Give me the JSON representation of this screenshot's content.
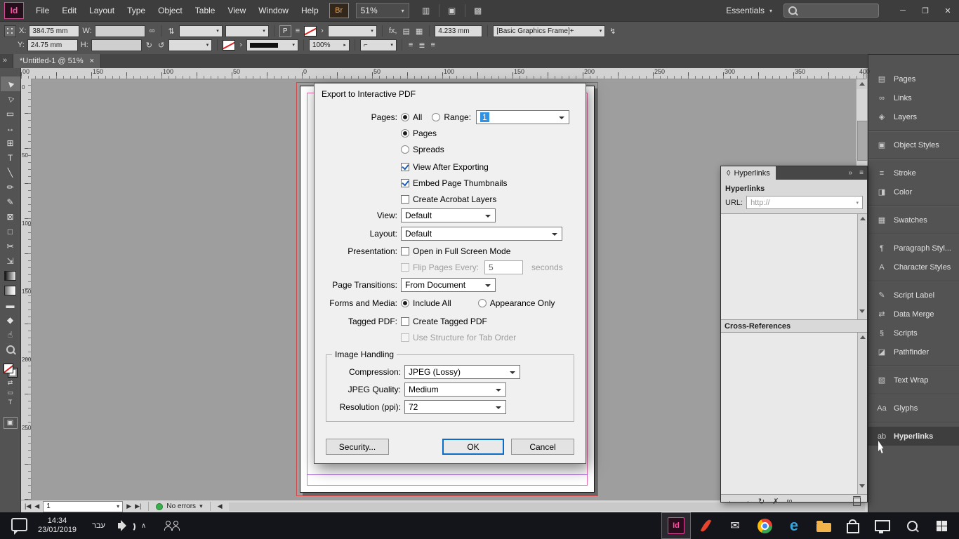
{
  "titlebar": {
    "logo": "Id",
    "menus": [
      "File",
      "Edit",
      "Layout",
      "Type",
      "Object",
      "Table",
      "View",
      "Window",
      "Help"
    ],
    "bridge": "Br",
    "zoom": "51%",
    "workspace": "Essentials",
    "minimize": "─",
    "restore": "❐",
    "close": "✕"
  },
  "control_panel": {
    "x_label": "X:",
    "x_value": "384.75 mm",
    "y_label": "Y:",
    "y_value": "24.75 mm",
    "w_label": "W:",
    "w_value": "",
    "h_label": "H:",
    "h_value": "",
    "scale_value": "100%",
    "gap_value": "4.233 mm",
    "style_value": "[Basic Graphics Frame]+",
    "p_badge": "P",
    "fx_label": "fx,"
  },
  "doc_tab": {
    "title": "*Untitled-1 @ 51%",
    "close": "×"
  },
  "rulers": {
    "h_labels": [
      "00",
      "150",
      "100",
      "50",
      "0",
      "50",
      "100",
      "150",
      "200",
      "250",
      "300",
      "350",
      "400"
    ],
    "v_labels": [
      "0",
      "50",
      "100",
      "150",
      "200",
      "250"
    ]
  },
  "tools": [
    "▶",
    "▷",
    "▭",
    "↔",
    "⊞",
    "T",
    "╲",
    "✏",
    "✎",
    "⊠",
    "□",
    "✂",
    "⇲",
    "",
    "",
    "▬",
    "◆",
    "☝",
    ""
  ],
  "glyphs": {
    "collapse_left": "»",
    "menu_icon_1": "▥",
    "menu_icon_2": "▣",
    "menu_icon_3": "▩",
    "workspace_caret": "▾",
    "flip_v": "⇅",
    "flip_h": "⇆",
    "rot_cw": "↻",
    "rot_ccw": "↺",
    "align_1": "≡",
    "align_2": "≣",
    "corner": "⌐",
    "scale_caret": "▸",
    "chain": "∞",
    "bolt": "↯",
    "text_icon": "▤",
    "grid_icon": "▦",
    "first_page": "|◀",
    "prev_page": "◀",
    "next_page": "▶",
    "last_page": "▶|",
    "errors_caret": "▾",
    "hscroll_left": "◀",
    "panel_diamond": "◊",
    "panel_collapse": "»",
    "panel_menu": "≡",
    "nav_prev": "←",
    "nav_next": "→",
    "refresh": "↻",
    "del": "✗",
    "link": "∞",
    "mini_1": "⇄",
    "mini_2": "▭",
    "mini_3": "T",
    "viewmode": "▣"
  },
  "dialog": {
    "title": "Export to Interactive PDF",
    "pages_label": "Pages:",
    "all_label": "All",
    "range_label": "Range:",
    "range_value": "1",
    "pages_option": "Pages",
    "spreads_option": "Spreads",
    "view_after_label": "View After Exporting",
    "embed_label": "Embed Page Thumbnails",
    "acrobat_label": "Create Acrobat Layers",
    "view_label": "View:",
    "view_value": "Default",
    "layout_label": "Layout:",
    "layout_value": "Default",
    "presentation_label": "Presentation:",
    "fullscreen_label": "Open in Full Screen Mode",
    "flip_label": "Flip Pages Every:",
    "flip_value": "5",
    "seconds_label": "seconds",
    "transitions_label": "Page Transitions:",
    "transitions_value": "From Document",
    "forms_label": "Forms and Media:",
    "include_all_label": "Include All",
    "appearance_label": "Appearance Only",
    "tagged_label": "Tagged PDF:",
    "tagged_option": "Create Tagged PDF",
    "structure_label": "Use Structure for Tab Order",
    "group_title": "Image Handling",
    "compression_label": "Compression:",
    "compression_value": "JPEG (Lossy)",
    "quality_label": "JPEG Quality:",
    "quality_value": "Medium",
    "resolution_label": "Resolution (ppi):",
    "resolution_value": "72",
    "security_button": "Security...",
    "ok_button": "OK",
    "cancel_button": "Cancel"
  },
  "hyperlinks_panel": {
    "tab_label": "Hyperlinks",
    "header": "Hyperlinks",
    "url_label": "URL:",
    "url_value": "http://",
    "crossrefs_header": "Cross-References"
  },
  "dock": {
    "items": [
      {
        "label": "Pages",
        "glyph": "▤"
      },
      {
        "label": "Links",
        "glyph": "∞"
      },
      {
        "label": "Layers",
        "glyph": "◈"
      },
      {
        "label": "Object Styles",
        "glyph": "▣"
      },
      {
        "label": "Stroke",
        "glyph": "≡"
      },
      {
        "label": "Color",
        "glyph": "◨"
      },
      {
        "label": "Swatches",
        "glyph": "▦"
      },
      {
        "label": "Paragraph Styl...",
        "glyph": "¶"
      },
      {
        "label": "Character Styles",
        "glyph": "A"
      },
      {
        "label": "Script Label",
        "glyph": "✎"
      },
      {
        "label": "Data Merge",
        "glyph": "⇄"
      },
      {
        "label": "Scripts",
        "glyph": "§"
      },
      {
        "label": "Pathfinder",
        "glyph": "◪"
      },
      {
        "label": "Text Wrap",
        "glyph": "▧"
      },
      {
        "label": "Glyphs",
        "glyph": "Aa"
      },
      {
        "label": "Hyperlinks",
        "glyph": "ab"
      }
    ]
  },
  "status_bar": {
    "page_value": "1",
    "errors_label": "No errors"
  },
  "taskbar": {
    "time": "14:34",
    "date": "23/01/2019",
    "language": "עבר",
    "indesign_badge": "Id",
    "edge_letter": "e"
  }
}
